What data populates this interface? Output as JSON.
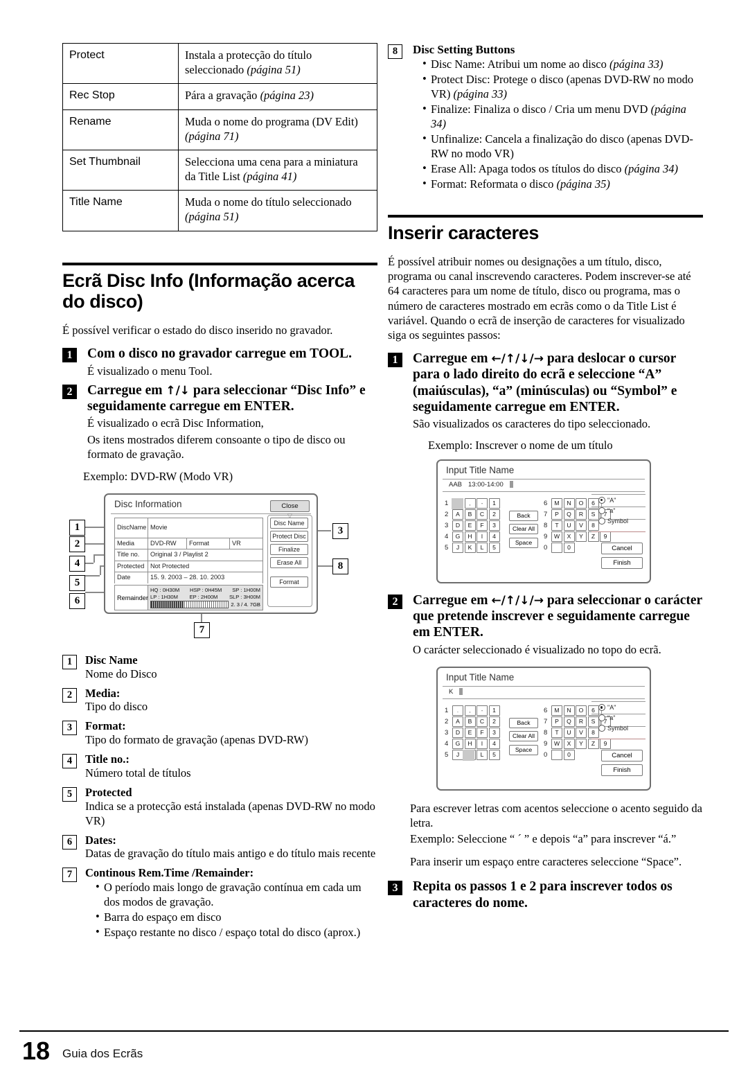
{
  "tool_table": {
    "rows": [
      {
        "key": "Protect",
        "desc": "Instala a protecção do título seleccionado ",
        "ref": "(página 51)"
      },
      {
        "key": "Rec Stop",
        "desc": "Pára a gravação ",
        "ref": "(página 23)"
      },
      {
        "key": "Rename",
        "desc": "Muda o nome do programa (DV Edit) ",
        "ref": "(página 71)"
      },
      {
        "key": "Set Thumbnail",
        "desc": "Selecciona uma cena para a miniatura da Title List ",
        "ref": "(página 41)"
      },
      {
        "key": "Title Name",
        "desc": "Muda o nome do título seleccionado ",
        "ref": "(página 51)"
      }
    ]
  },
  "disc_setting": {
    "number": "8",
    "title": "Disc Setting Buttons",
    "items": [
      {
        "text": "Disc Name: Atribui um nome ao disco ",
        "ref": "(página 33)"
      },
      {
        "text": "Protect Disc: Protege o disco (apenas DVD-RW no modo VR) ",
        "ref": "(página 33)"
      },
      {
        "text": "Finalize: Finaliza o disco / Cria um menu DVD ",
        "ref": "(página 34)"
      },
      {
        "text": "Unfinalize: Cancela a finalização do disco (apenas DVD-RW no modo VR)",
        "ref": ""
      },
      {
        "text": "Erase All: Apaga todos os títulos do disco ",
        "ref": "(página 34)"
      },
      {
        "text": "Format: Reformata o disco ",
        "ref": "(página 35)"
      }
    ]
  },
  "disc_info_section": {
    "heading": "Ecrã Disc Info (Informação acerca do disco)",
    "intro": "É possível verificar o estado do disco inserido no gravador.",
    "step1_num": "1",
    "step1_head": "Com o disco no gravador carregue em TOOL.",
    "step1_sub": "É visualizado o menu Tool.",
    "step2_num": "2",
    "step2_head_a": "Carregue em ",
    "step2_arrows": "↑/↓",
    "step2_head_b": " para seleccionar “Disc Info” e seguidamente carregue em ENTER.",
    "step2_sub1": "É visualizado o ecrã Disc Information,",
    "step2_sub2": "Os itens mostrados diferem consoante o tipo de disco ou formato de gravação.",
    "exemplo": "Exemplo: DVD-RW (Modo VR)"
  },
  "disc_info_screen": {
    "title": "Disc Information",
    "rows": {
      "disc_name_label": "DiscName",
      "disc_name_value": "Movie",
      "media_label": "Media",
      "media_value": "DVD-RW",
      "format_label": "Format",
      "format_value": "VR",
      "title_no_label": "Title no.",
      "title_no_value": "Original 3 / Playlist 2",
      "protected_label": "Protected",
      "protected_value": "Not Protected",
      "date_label": "Date",
      "date_value": "15. 9. 2003 –  28. 10. 2003",
      "remainder_label": "Remainder"
    },
    "remainder": {
      "hq": "HQ : 0H30M",
      "hsp": "HSP : 0H45M",
      "sp": "SP : 1H00M",
      "lp": "LP : 1H30M",
      "ep": "EP : 2H00M",
      "slp": "SLP : 3H00M",
      "capacity": "2. 3 / 4. 7GB"
    },
    "close": "Close",
    "buttons": [
      "Disc Name",
      "Protect Disc",
      "Finalize",
      "Erase All",
      "Format"
    ],
    "callouts": [
      "1",
      "2",
      "4",
      "5",
      "6",
      "3",
      "8",
      "7"
    ]
  },
  "legend": [
    {
      "num": "1",
      "title": "Disc Name",
      "desc": "Nome do Disco"
    },
    {
      "num": "2",
      "title": "Media:",
      "desc": "Tipo do disco"
    },
    {
      "num": "3",
      "title": "Format:",
      "desc": "Tipo do formato de gravação (apenas DVD-RW)"
    },
    {
      "num": "4",
      "title": "Title no.:",
      "desc": "Número total de títulos"
    },
    {
      "num": "5",
      "title": "Protected",
      "desc": "Indica se a protecção está instalada (apenas DVD-RW no modo VR)"
    },
    {
      "num": "6",
      "title": "Dates:",
      "desc": "Datas de gravação do título mais antigo e do título mais recente"
    }
  ],
  "legend7": {
    "num": "7",
    "title": "Continous Rem.Time /Remainder:",
    "bullets": [
      "O período mais longo de gravação contínua em cada um dos modos de gravação.",
      "Barra do espaço em disco",
      "Espaço restante no disco / espaço total do disco (aprox.)"
    ]
  },
  "inserir": {
    "heading": "Inserir caracteres",
    "intro": "É possível atribuir nomes ou designações a um título, disco, programa ou canal inscrevendo caracteres. Podem inscrever-se até 64 caracteres para um nome de título, disco ou programa, mas o número de caracteres mostrado em ecrãs como o da Title List é variável. Quando o ecrã de inserção de caracteres for visualizado siga os seguintes passos:",
    "step1_num": "1",
    "step1_head_a": "Carregue em ",
    "step1_arrows": "←/↑/↓/→",
    "step1_head_b": " para deslocar o cursor para o lado direito do ecrã e seleccione “A” (maiúsculas), “a” (minúsculas) ou “Symbol” e seguidamente carregue em ENTER.",
    "step1_sub": "São visualizados os caracteres do tipo seleccionado.",
    "exemplo1": "Exemplo: Inscrever o nome de um título",
    "step2_num": "2",
    "step2_head_a": "Carregue em ",
    "step2_arrows": "←/↑/↓/→",
    "step2_head_b": " para seleccionar o carácter que pretende inscrever e seguidamente carregue em ENTER.",
    "step2_sub": "O carácter seleccionado é visualizado no topo do ecrã.",
    "after1": "Para escrever letras com acentos seleccione o acento seguido da letra.",
    "after2": "Exemplo: Seleccione “ ´ ” e depois “a” para inscrever “á.”",
    "after3": "Para inserir um espaço entre caracteres seleccione “Space”.",
    "step3_num": "3",
    "step3_head": "Repita os passos 1 e 2 para inscrever todos os caracteres do nome."
  },
  "keyboard": {
    "title": "Input Title Name",
    "entry1_text": "AAB",
    "entry1_time": "13:00-14:00",
    "entry2_text": "K",
    "rows": [
      {
        "lead": "1",
        "keys": [
          ".",
          ",",
          "-",
          "1"
        ]
      },
      {
        "lead": "2",
        "keys": [
          "A",
          "B",
          "C",
          "2"
        ]
      },
      {
        "lead": "3",
        "keys": [
          "D",
          "E",
          "F",
          "3"
        ]
      },
      {
        "lead": "4",
        "keys": [
          "G",
          "H",
          "I",
          "4"
        ]
      },
      {
        "lead": "5",
        "keys": [
          "J",
          "K",
          "L",
          "5"
        ]
      }
    ],
    "rows_right": [
      {
        "lead": "6",
        "keys": [
          "M",
          "N",
          "O",
          "6"
        ]
      },
      {
        "lead": "7",
        "keys": [
          "P",
          "Q",
          "R",
          "S",
          "7"
        ]
      },
      {
        "lead": "8",
        "keys": [
          "T",
          "U",
          "V",
          "8"
        ]
      },
      {
        "lead": "9",
        "keys": [
          "W",
          "X",
          "Y",
          "Z",
          "9"
        ]
      },
      {
        "lead": "0",
        "keys": [
          "",
          "0"
        ]
      }
    ],
    "mid_buttons": [
      "Back",
      "Clear All",
      "Space"
    ],
    "options": [
      {
        "label": "\"A\"",
        "selected": true
      },
      {
        "label": "\"a\"",
        "selected": false
      },
      {
        "label": "Symbol",
        "selected": false
      }
    ],
    "cancel": "Cancel",
    "finish": "Finish"
  },
  "footer": {
    "page": "18",
    "label": "Guia dos Ecrãs"
  }
}
